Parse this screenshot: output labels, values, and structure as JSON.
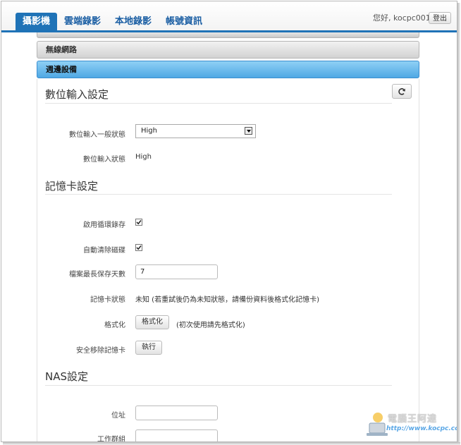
{
  "nav": {
    "tabs": [
      {
        "label": "攝影機",
        "active": true
      },
      {
        "label": "雲端錄影",
        "active": false
      },
      {
        "label": "本地錄影",
        "active": false
      },
      {
        "label": "帳號資訊",
        "active": false
      }
    ],
    "greeting": "您好, kocpc001",
    "logout_label": "登出"
  },
  "accordion": {
    "wifi_label": "無線網路",
    "peripherals_label": "週邊設備"
  },
  "digital_input": {
    "title": "數位輸入設定",
    "refresh_icon": "refresh-icon",
    "normal_state_label": "數位輸入一般狀態",
    "normal_state_value": "High",
    "state_label": "數位輸入狀態",
    "state_value": "High"
  },
  "memory_card": {
    "title": "記憶卡設定",
    "loop_record_label": "啟用循環錄存",
    "loop_record_checked": true,
    "auto_clean_label": "自動清除磁碟",
    "auto_clean_checked": true,
    "max_days_label": "檔案最長保存天數",
    "max_days_value": "7",
    "status_label": "記憶卡狀態",
    "status_value": "未知 (若重試後仍為未知狀態，請備份資料後格式化記憶卡)",
    "format_label": "格式化",
    "format_button": "格式化",
    "format_hint": "(初次使用請先格式化)",
    "eject_label": "安全移除記憶卡",
    "eject_button": "執行"
  },
  "nas": {
    "title": "NAS設定",
    "address_label": "位址",
    "address_value": "",
    "workgroup_label": "工作群組",
    "workgroup_value": ""
  },
  "watermark": {
    "name": "電腦王阿達",
    "url": "http://www.kocpc.com.tw"
  },
  "colors": {
    "accent": "#1f73b7",
    "active_bar": "#5aaee8"
  }
}
